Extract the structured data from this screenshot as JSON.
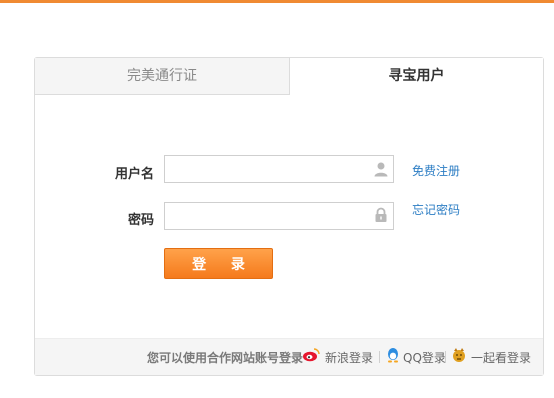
{
  "tabs": [
    {
      "label": "完美通行证",
      "active": false
    },
    {
      "label": "寻宝用户",
      "active": true
    }
  ],
  "form": {
    "username_label": "用户名",
    "password_label": "密码",
    "username_value": "",
    "password_value": "",
    "register_link": "免费注册",
    "forgot_link": "忘记密码",
    "login_button": "登 录"
  },
  "footer": {
    "prompt": "您可以使用合作网站账号登录",
    "partners": [
      {
        "label": "新浪登录",
        "icon": "weibo-icon"
      },
      {
        "label": "QQ登录",
        "icon": "qq-penguin-icon"
      },
      {
        "label": "一起看登录",
        "icon": "tiger-icon"
      }
    ]
  },
  "colors": {
    "accent": "#f08a32",
    "button": "#f57a1c",
    "link": "#2d7ec4"
  }
}
